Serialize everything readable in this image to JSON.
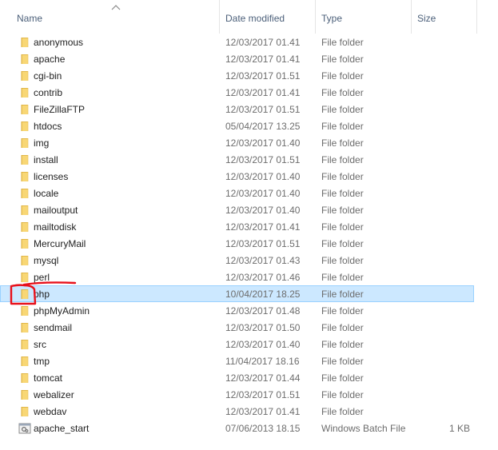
{
  "columns": {
    "name": "Name",
    "date": "Date modified",
    "type": "Type",
    "size": "Size"
  },
  "colors": {
    "selection_fill": "#cce8ff",
    "selection_border": "#99d1ff",
    "folder": "#f8d775",
    "annotation": "#e8111b"
  },
  "rows": [
    {
      "icon": "folder-icon",
      "name": "anonymous",
      "date": "12/03/2017 01.41",
      "type": "File folder",
      "size": ""
    },
    {
      "icon": "folder-icon",
      "name": "apache",
      "date": "12/03/2017 01.41",
      "type": "File folder",
      "size": ""
    },
    {
      "icon": "folder-icon",
      "name": "cgi-bin",
      "date": "12/03/2017 01.51",
      "type": "File folder",
      "size": ""
    },
    {
      "icon": "folder-icon",
      "name": "contrib",
      "date": "12/03/2017 01.41",
      "type": "File folder",
      "size": ""
    },
    {
      "icon": "folder-icon",
      "name": "FileZillaFTP",
      "date": "12/03/2017 01.51",
      "type": "File folder",
      "size": ""
    },
    {
      "icon": "folder-icon",
      "name": "htdocs",
      "date": "05/04/2017 13.25",
      "type": "File folder",
      "size": ""
    },
    {
      "icon": "folder-icon",
      "name": "img",
      "date": "12/03/2017 01.40",
      "type": "File folder",
      "size": ""
    },
    {
      "icon": "folder-icon",
      "name": "install",
      "date": "12/03/2017 01.51",
      "type": "File folder",
      "size": ""
    },
    {
      "icon": "folder-icon",
      "name": "licenses",
      "date": "12/03/2017 01.40",
      "type": "File folder",
      "size": ""
    },
    {
      "icon": "folder-icon",
      "name": "locale",
      "date": "12/03/2017 01.40",
      "type": "File folder",
      "size": ""
    },
    {
      "icon": "folder-icon",
      "name": "mailoutput",
      "date": "12/03/2017 01.40",
      "type": "File folder",
      "size": ""
    },
    {
      "icon": "folder-icon",
      "name": "mailtodisk",
      "date": "12/03/2017 01.41",
      "type": "File folder",
      "size": ""
    },
    {
      "icon": "folder-icon",
      "name": "MercuryMail",
      "date": "12/03/2017 01.51",
      "type": "File folder",
      "size": ""
    },
    {
      "icon": "folder-icon",
      "name": "mysql",
      "date": "12/03/2017 01.43",
      "type": "File folder",
      "size": ""
    },
    {
      "icon": "folder-icon",
      "name": "perl",
      "date": "12/03/2017 01.46",
      "type": "File folder",
      "size": ""
    },
    {
      "icon": "folder-icon",
      "name": "php",
      "date": "10/04/2017 18.25",
      "type": "File folder",
      "size": "",
      "selected": true
    },
    {
      "icon": "folder-icon",
      "name": "phpMyAdmin",
      "date": "12/03/2017 01.48",
      "type": "File folder",
      "size": ""
    },
    {
      "icon": "folder-icon",
      "name": "sendmail",
      "date": "12/03/2017 01.50",
      "type": "File folder",
      "size": ""
    },
    {
      "icon": "folder-icon",
      "name": "src",
      "date": "12/03/2017 01.40",
      "type": "File folder",
      "size": ""
    },
    {
      "icon": "folder-icon",
      "name": "tmp",
      "date": "11/04/2017 18.16",
      "type": "File folder",
      "size": ""
    },
    {
      "icon": "folder-icon",
      "name": "tomcat",
      "date": "12/03/2017 01.44",
      "type": "File folder",
      "size": ""
    },
    {
      "icon": "folder-icon",
      "name": "webalizer",
      "date": "12/03/2017 01.51",
      "type": "File folder",
      "size": ""
    },
    {
      "icon": "folder-icon",
      "name": "webdav",
      "date": "12/03/2017 01.41",
      "type": "File folder",
      "size": ""
    },
    {
      "icon": "batch-file-icon",
      "name": "apache_start",
      "date": "07/06/2013 18.15",
      "type": "Windows Batch File",
      "size": "1 KB"
    }
  ]
}
